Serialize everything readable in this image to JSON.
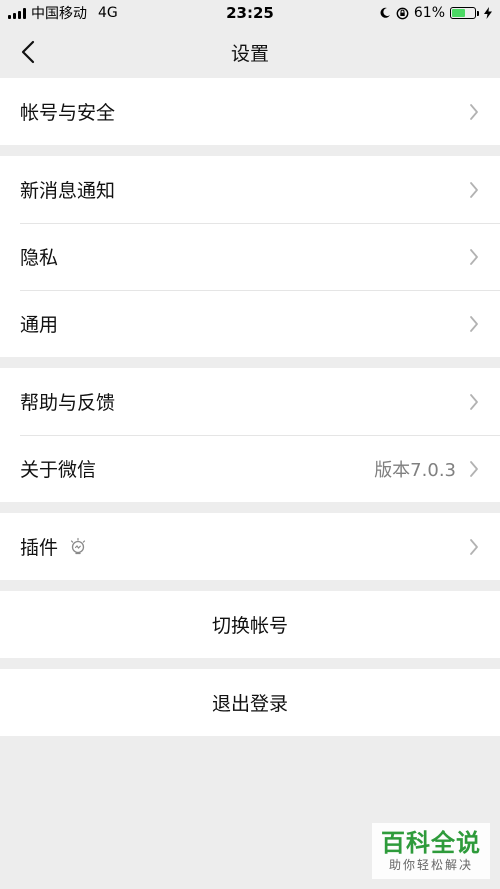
{
  "status_bar": {
    "carrier": "中国移动",
    "network": "4G",
    "time": "23:25",
    "battery_percent": "61%",
    "battery_level": 0.61,
    "battery_color": "#4cd964"
  },
  "nav": {
    "back_icon": "chevron-left-icon",
    "title": "设置"
  },
  "groups": [
    {
      "items": [
        {
          "label": "帐号与安全"
        }
      ]
    },
    {
      "items": [
        {
          "label": "新消息通知"
        },
        {
          "label": "隐私"
        },
        {
          "label": "通用"
        }
      ]
    },
    {
      "items": [
        {
          "label": "帮助与反馈"
        },
        {
          "label": "关于微信",
          "value": "版本7.0.3"
        }
      ]
    },
    {
      "items": [
        {
          "label": "插件",
          "icon": "lightbulb-icon"
        }
      ]
    }
  ],
  "actions": {
    "switch_account": "切换帐号",
    "logout": "退出登录"
  },
  "watermark": {
    "title": "百科全说",
    "subtitle": "助你轻松解决"
  }
}
